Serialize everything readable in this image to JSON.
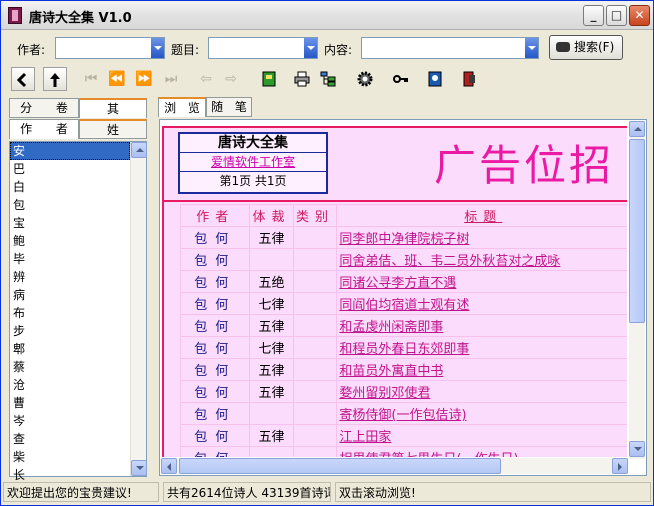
{
  "window": {
    "title": "唐诗大全集 V1.0",
    "min": "_",
    "max": "□",
    "close": "✕"
  },
  "search": {
    "author_label": "作者:",
    "author_value": "",
    "title_label": "题目:",
    "title_value": "",
    "content_label": "内容:",
    "content_value": "",
    "button_label": "搜索(F)"
  },
  "left_tabs": [
    {
      "label": "分 卷",
      "active": false
    },
    {
      "label": "其 它",
      "active": true
    },
    {
      "label": "作 者",
      "active": true
    },
    {
      "label": "姓 氏",
      "active": false
    }
  ],
  "surnames": [
    "安",
    "巴",
    "白",
    "包",
    "宝",
    "鲍",
    "毕",
    "辨",
    "病",
    "布",
    "步",
    "郫",
    "蔡",
    "沧",
    "曹",
    "岑",
    "查",
    "柴",
    "长"
  ],
  "selected_surname": "安",
  "right_tabs": [
    {
      "label": "浏 览",
      "active": true
    },
    {
      "label": "随 笔",
      "active": false
    }
  ],
  "header": {
    "app_name": "唐诗大全集",
    "studio": "爱情软件工作室",
    "page_info": "第1页 共1页",
    "ad": "广告位招"
  },
  "table": {
    "columns": [
      "作者",
      "体裁",
      "类别",
      "标题"
    ],
    "rows": [
      {
        "author": "包何",
        "style": "五律",
        "category": "",
        "title": "同李郎中净律院梡子树"
      },
      {
        "author": "包何",
        "style": "",
        "category": "",
        "title": "同舍弟佶、班、韦二员外秋苔对之成咏"
      },
      {
        "author": "包何",
        "style": "五绝",
        "category": "",
        "title": "同诸公寻李方直不遇"
      },
      {
        "author": "包何",
        "style": "七律",
        "category": "",
        "title": "同阎伯均宿道士观有述"
      },
      {
        "author": "包何",
        "style": "五律",
        "category": "",
        "title": "和孟虔州闲斋即事"
      },
      {
        "author": "包何",
        "style": "七律",
        "category": "",
        "title": "和程员外春日东郊即事"
      },
      {
        "author": "包何",
        "style": "五律",
        "category": "",
        "title": "和苗员外寓直中书"
      },
      {
        "author": "包何",
        "style": "五律",
        "category": "",
        "title": "婺州留别邓使君"
      },
      {
        "author": "包何",
        "style": "",
        "category": "",
        "title": "寄杨侍御(一作包佶诗)"
      },
      {
        "author": "包何",
        "style": "五律",
        "category": "",
        "title": "江上田家"
      },
      {
        "author": "包何",
        "style": "",
        "category": "",
        "title": "相里使君第七男生日(一作生日)"
      }
    ]
  },
  "status": {
    "welcome": "欢迎提出您的宝贵建议!",
    "counts": "共有2614位诗人 43139首诗词",
    "hint": "双击滚动浏览!"
  },
  "colors": {
    "accent": "#e81a64",
    "link": "#c0148c",
    "ad": "#ea1aa4",
    "selection": "#316ac5"
  }
}
